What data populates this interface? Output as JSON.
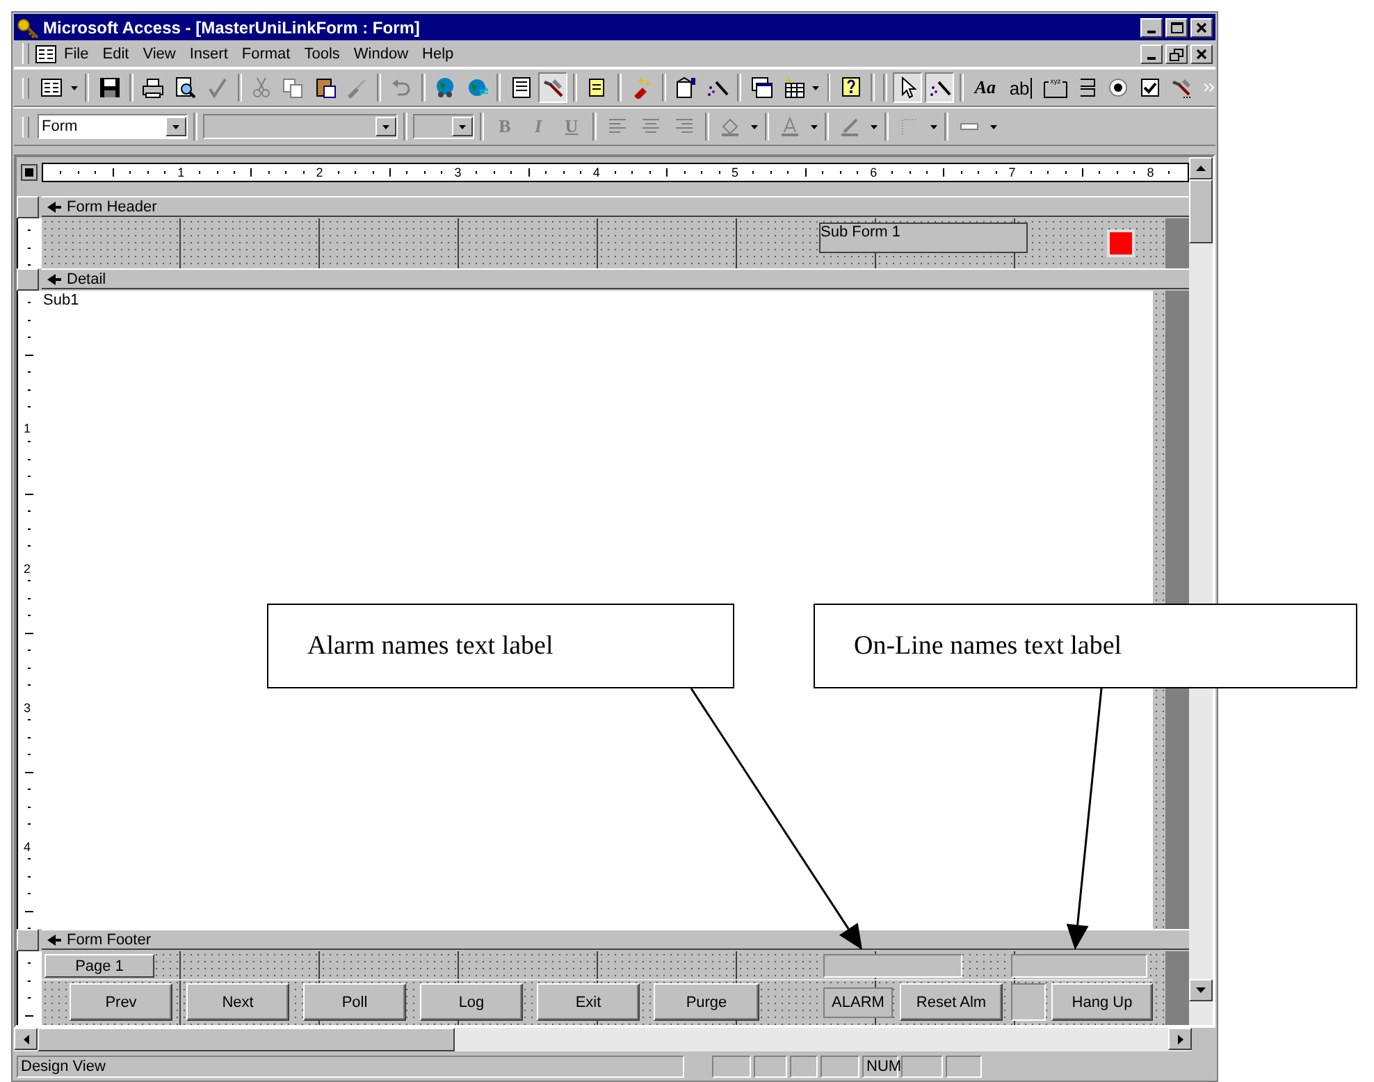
{
  "window": {
    "title": "Microsoft Access - [MasterUniLinkForm : Form]"
  },
  "menu_bar": {
    "items": [
      "File",
      "Edit",
      "View",
      "Insert",
      "Format",
      "Tools",
      "Window",
      "Help"
    ]
  },
  "toolbox": {
    "label_tool": "Aa",
    "textbox_tool": "ab",
    "frame_tool": "xyz"
  },
  "formatting_toolbar": {
    "object_combo": "Form",
    "bold": "B",
    "italic": "I",
    "underline": "U"
  },
  "ruler": {
    "labels": [
      "1",
      "2",
      "3",
      "4",
      "5",
      "6",
      "7",
      "8"
    ]
  },
  "vertical_ruler": {
    "labels": [
      "1",
      "2",
      "3",
      "4"
    ]
  },
  "sections": [
    {
      "kind": "header",
      "title": "Form Header",
      "controls": [
        {
          "kind": "subform",
          "text": "Sub Form 1"
        },
        {
          "kind": "colorbox",
          "color": "#ff0000"
        }
      ]
    },
    {
      "kind": "detail",
      "title": "Detail",
      "controls": [
        {
          "kind": "label",
          "text": "Sub1"
        }
      ]
    },
    {
      "kind": "footer",
      "title": "Form Footer",
      "controls": [
        {
          "kind": "label",
          "text": "Page 1"
        },
        {
          "kind": "textbox"
        },
        {
          "kind": "textbox"
        },
        {
          "kind": "button",
          "text": "Prev"
        },
        {
          "kind": "button",
          "text": "Next"
        },
        {
          "kind": "button",
          "text": "Poll"
        },
        {
          "kind": "button",
          "text": "Log"
        },
        {
          "kind": "button",
          "text": "Exit"
        },
        {
          "kind": "button",
          "text": "Purge"
        },
        {
          "kind": "label",
          "text": "ALARM"
        },
        {
          "kind": "button",
          "text": "Reset Alm"
        },
        {
          "kind": "box"
        },
        {
          "kind": "button",
          "text": "Hang Up"
        }
      ]
    }
  ],
  "status_bar": {
    "text": "Design View",
    "indicators": [
      "NUM"
    ]
  },
  "callouts": [
    {
      "text": "Alarm names text label"
    },
    {
      "text": "On-Line names text label"
    }
  ]
}
